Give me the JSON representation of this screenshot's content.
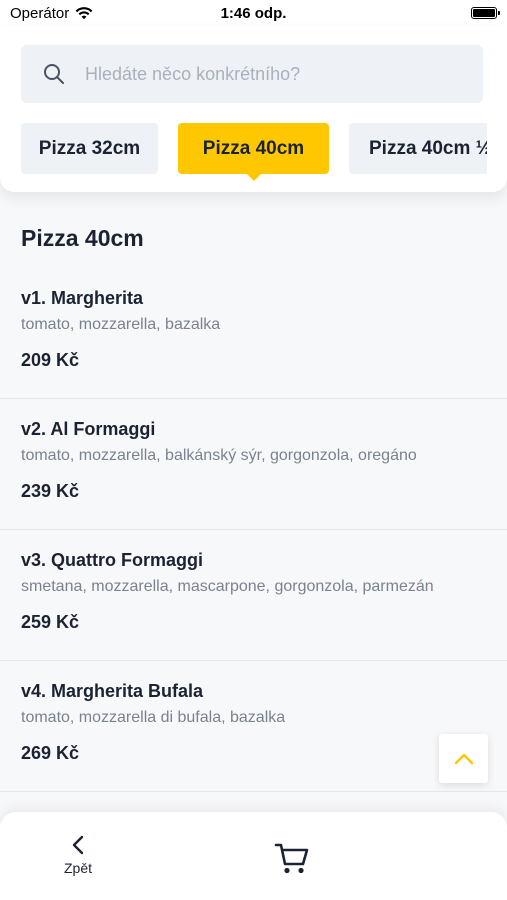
{
  "status_bar": {
    "carrier": "Operátor",
    "time": "1:46 odp.",
    "wifi_icon": "wifi-icon",
    "battery_icon": "battery-icon"
  },
  "search": {
    "placeholder": "Hledáte něco konkrétního?",
    "icon": "search-icon"
  },
  "tabs": [
    {
      "label": "Pizza 32cm",
      "active": false
    },
    {
      "label": "Pizza 40cm",
      "active": true
    },
    {
      "label": "Pizza 40cm ½",
      "active": false
    }
  ],
  "section": {
    "title": "Pizza 40cm"
  },
  "items": [
    {
      "name": "v1. Margherita",
      "description": "tomato, mozzarella, bazalka",
      "price": "209 Kč"
    },
    {
      "name": "v2. Al Formaggi",
      "description": "tomato, mozzarella, balkánský sýr, gorgonzola, oregáno",
      "price": "239 Kč"
    },
    {
      "name": "v3. Quattro Formaggi",
      "description": "smetana, mozzarella, mascarpone, gorgonzola, parmezán",
      "price": "259 Kč"
    },
    {
      "name": "v4. Margherita Bufala",
      "description": "tomato, mozzarella di bufala, bazalka",
      "price": "269 Kč"
    },
    {
      "name": "",
      "description": "",
      "price": ""
    }
  ],
  "scroll_top": {
    "icon": "chevron-up-icon"
  },
  "bottom_nav": {
    "back_label": "Zpět",
    "back_icon": "chevron-left-icon",
    "cart_icon": "cart-icon"
  },
  "colors": {
    "accent": "#ffc700",
    "text": "#1b2333",
    "muted": "#7a8290",
    "background": "#f7f8fa"
  }
}
